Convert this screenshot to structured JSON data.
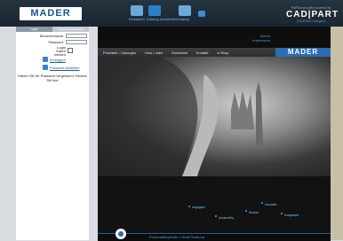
{
  "header": {
    "logo": "MADER",
    "icons": [
      {
        "name": "shopping-icon",
        "label": "Einkaufen",
        "color": "#6aa9d8"
      },
      {
        "name": "katalog-icon",
        "label": "Katalog Auswählen",
        "color": "#2c7fc6"
      },
      {
        "name": "katalog-icon-2",
        "label": "Katalog",
        "color": "#6aa9d8"
      },
      {
        "name": "info-icon",
        "label": "",
        "color": "#3d8ed3"
      }
    ],
    "brand_top": "PARTcommunity powered by",
    "brand_main": "CAD|PART",
    "brand_sub": "CADENAS Navigator"
  },
  "sidebar": {
    "tabs": [
      "Login",
      "Passwort anfordern"
    ],
    "fields": [
      {
        "label": "Benutzername:",
        "value": ""
      },
      {
        "label": "Passwort:",
        "value": ""
      }
    ],
    "login_label": "Login Daten merken",
    "links": [
      "Einloggen",
      "Passwort bestellen"
    ],
    "note": "Haben Sie Ihr Passwort vergessen? Klicken Sie hier"
  },
  "main": {
    "strip_links": [
      "Ihrena",
      "Impressum"
    ],
    "nav": [
      "Produkte • Lösungen",
      "Inno • Jobs",
      "Download",
      "Kontakt",
      "e-Shop"
    ],
    "nav_logo": "MADER",
    "keywords": [
      "engagiert",
      "trustworthy",
      "flexibel",
      "innovativ",
      "kompetent"
    ],
    "bottom_text": "Pneumatikzylinder | Ventil Startuna"
  }
}
